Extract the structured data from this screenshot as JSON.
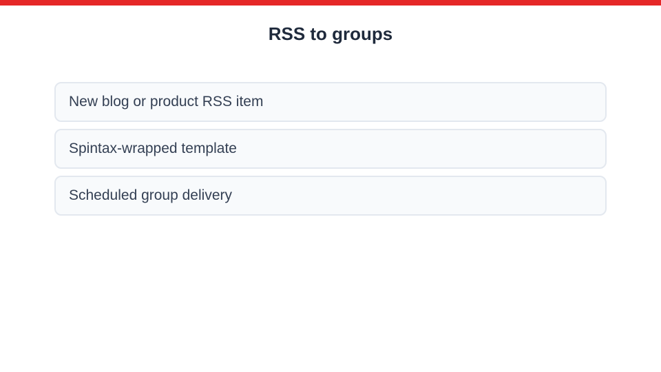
{
  "colors": {
    "accent_bar": "#e52727",
    "title": "#1f2a3c",
    "item_text": "#344054",
    "item_bg": "#f8fafc",
    "item_border": "#e3e8ef"
  },
  "header": {
    "title": "RSS to groups"
  },
  "steps": [
    {
      "label": "New blog or product RSS item"
    },
    {
      "label": "Spintax-wrapped template"
    },
    {
      "label": "Scheduled group delivery"
    }
  ]
}
